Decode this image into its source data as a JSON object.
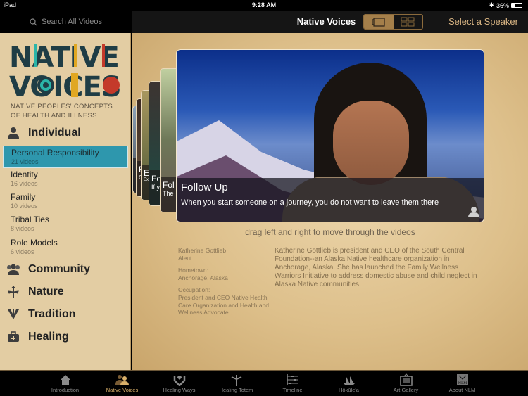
{
  "status_bar": {
    "device": "iPad",
    "time": "9:28 AM",
    "battery": "36%"
  },
  "nav": {
    "search_placeholder": "Search All Videos",
    "title": "Native Voices",
    "view_modes": [
      {
        "name": "carousel",
        "active": true
      },
      {
        "name": "grid",
        "active": false
      }
    ],
    "speaker_button": "Select a Speaker"
  },
  "logo": {
    "line1": "NATIVE",
    "line2": "VOICES",
    "tagline_1": "NATIVE PEOPLES' CONCEPTS",
    "tagline_2": "OF HEALTH AND ILLNESS"
  },
  "sidebar": {
    "categories": [
      {
        "label": "Individual",
        "icon": "person-icon"
      },
      {
        "label": "Community",
        "icon": "group-icon"
      },
      {
        "label": "Nature",
        "icon": "plant-icon"
      },
      {
        "label": "Tradition",
        "icon": "arrow-feather-icon"
      },
      {
        "label": "Healing",
        "icon": "medical-kit-icon"
      }
    ],
    "subtopics": [
      {
        "name": "Personal Responsibility",
        "count": "21 videos",
        "selected": true
      },
      {
        "name": "Identity",
        "count": "16 videos",
        "selected": false
      },
      {
        "name": "Family",
        "count": "10 videos",
        "selected": false
      },
      {
        "name": "Tribal Ties",
        "count": "8 videos",
        "selected": false
      },
      {
        "name": "Role Models",
        "count": "6 videos",
        "selected": false
      }
    ]
  },
  "carousel": {
    "stacked": [
      {
        "title": "E",
        "sub": ""
      },
      {
        "title": "E",
        "sub": "O"
      },
      {
        "title": "E:",
        "sub": "Ex"
      },
      {
        "title": "Fe",
        "sub": "If y"
      },
      {
        "title": "Fol",
        "sub": "The"
      }
    ],
    "current": {
      "title": "Follow Up",
      "quote": "When you start someone on a journey, you do not want to leave them there"
    },
    "hint": "drag left and right to move through the videos"
  },
  "speaker": {
    "name": "Katherine Gottlieb",
    "tribe": "Aleut",
    "hometown_label": "Hometown:",
    "hometown": "Anchorage, Alaska",
    "occupation_label": "Occupation:",
    "occupation": "President and CEO Native Health Care Organization and Health and Wellness Advocate",
    "bio": "Katherine Gottlieb is president and CEO of the South Central Foundation--an Alaska Native healthcare organization in Anchorage, Alaska. She has launched the Family Wellness Warriors Initiative to address domestic abuse and child neglect in Alaska Native communities."
  },
  "tabbar": [
    {
      "label": "Introduction",
      "icon": "house-icon",
      "active": false
    },
    {
      "label": "Native Voices",
      "icon": "people-icon",
      "active": true
    },
    {
      "label": "Healing Ways",
      "icon": "hands-heart-icon",
      "active": false
    },
    {
      "label": "Healing Totem",
      "icon": "totem-icon",
      "active": false
    },
    {
      "label": "Timeline",
      "icon": "timeline-icon",
      "active": false
    },
    {
      "label": "Hōkūle'a",
      "icon": "canoe-icon",
      "active": false
    },
    {
      "label": "Art Gallery",
      "icon": "frame-icon",
      "active": false
    },
    {
      "label": "About NLM",
      "icon": "nlm-icon",
      "active": false
    }
  ],
  "colors": {
    "accent": "#2e97ad",
    "gold": "#d9b06a",
    "sidebar_bg": "#e3cda3"
  }
}
